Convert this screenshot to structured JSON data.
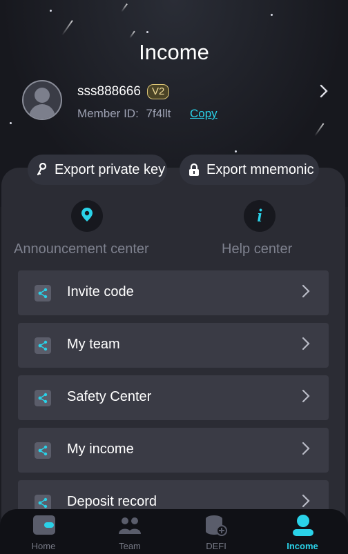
{
  "header": {
    "title": "Income"
  },
  "profile": {
    "username": "sss888666",
    "level": "V2",
    "member_id_label": "Member ID:",
    "member_id": "7f4llt",
    "copy_label": "Copy"
  },
  "actions": {
    "export_private_key": "Export private key",
    "export_mnemonic": "Export mnemonic"
  },
  "quick": {
    "announcement": "Announcement center",
    "help": "Help center"
  },
  "menu": [
    {
      "label": "Invite code"
    },
    {
      "label": "My team"
    },
    {
      "label": "Safety Center"
    },
    {
      "label": "My income"
    },
    {
      "label": "Deposit record"
    }
  ],
  "tabs": [
    {
      "label": "Home",
      "icon": "wallet-icon"
    },
    {
      "label": "Team",
      "icon": "team-icon"
    },
    {
      "label": "DEFI",
      "icon": "coins-icon"
    },
    {
      "label": "Income",
      "icon": "user-icon"
    }
  ],
  "active_tab": "Income",
  "colors": {
    "accent": "#2ad2e8",
    "badge": "#f1dc9b",
    "background": "#1b1c22"
  }
}
